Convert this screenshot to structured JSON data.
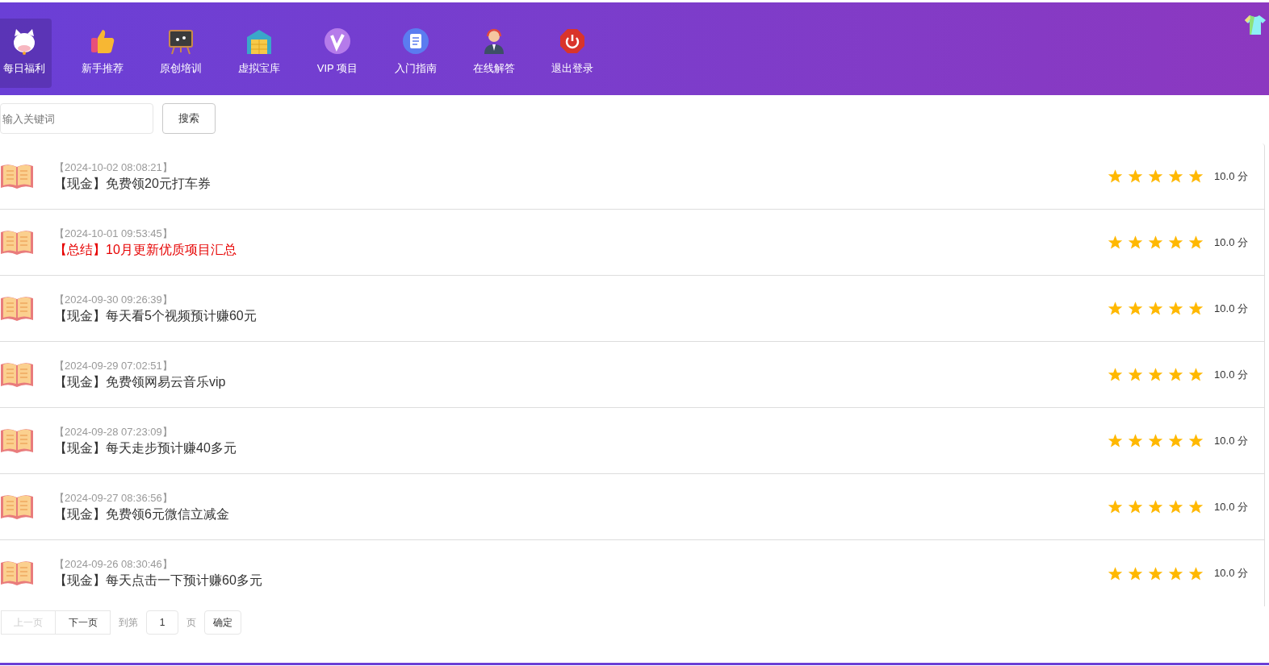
{
  "nav": [
    {
      "label": "每日福利",
      "selected": true
    },
    {
      "label": "新手推荐",
      "selected": false
    },
    {
      "label": "原创培训",
      "selected": false
    },
    {
      "label": "虚拟宝库",
      "selected": false
    },
    {
      "label": "VIP 项目",
      "selected": false
    },
    {
      "label": "入门指南",
      "selected": false
    },
    {
      "label": "在线解答",
      "selected": false
    },
    {
      "label": "退出登录",
      "selected": false
    }
  ],
  "search": {
    "placeholder": "输入关键词",
    "button": "搜索"
  },
  "articles": [
    {
      "time": "【2024-10-02 08:08:21】",
      "title": "【现金】免费领20元打车券",
      "highlighted": false,
      "stars": 5,
      "score": "10.0 分"
    },
    {
      "time": "【2024-10-01 09:53:45】",
      "title": "【总结】10月更新优质项目汇总",
      "highlighted": true,
      "stars": 5,
      "score": "10.0 分"
    },
    {
      "time": "【2024-09-30 09:26:39】",
      "title": "【现金】每天看5个视频预计赚60元",
      "highlighted": false,
      "stars": 5,
      "score": "10.0 分"
    },
    {
      "time": "【2024-09-29 07:02:51】",
      "title": "【现金】免费领网易云音乐vip",
      "highlighted": false,
      "stars": 5,
      "score": "10.0 分"
    },
    {
      "time": "【2024-09-28 07:23:09】",
      "title": "【现金】每天走步预计赚40多元",
      "highlighted": false,
      "stars": 5,
      "score": "10.0 分"
    },
    {
      "time": "【2024-09-27 08:36:56】",
      "title": "【现金】免费领6元微信立减金",
      "highlighted": false,
      "stars": 5,
      "score": "10.0 分"
    },
    {
      "time": "【2024-09-26 08:30:46】",
      "title": "【现金】每天点击一下预计赚60多元",
      "highlighted": false,
      "stars": 5,
      "score": "10.0 分"
    }
  ],
  "pagination": {
    "prev": {
      "label": "上一页",
      "disabled": true
    },
    "next": {
      "label": "下一页",
      "disabled": false
    },
    "goto_label": "到第",
    "page": "1",
    "page_label": "页",
    "confirm": "确定"
  }
}
